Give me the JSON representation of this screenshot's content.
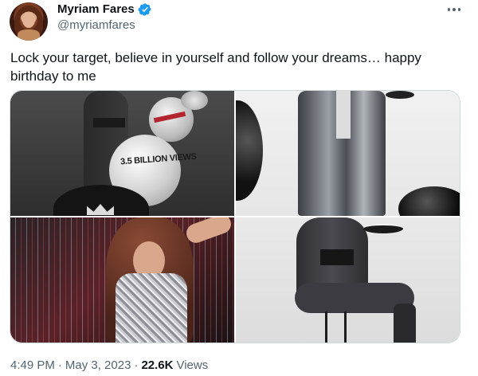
{
  "author": {
    "display_name": "Myriam Fares",
    "handle": "@myriamfares",
    "verified": true
  },
  "tweet": {
    "text": "Lock your target, believe in yourself and follow your dreams… happy birthday to me"
  },
  "media": {
    "image_overlay_text": "3.5 BILLION VIEWS"
  },
  "meta": {
    "time": "4:49 PM",
    "separator": "·",
    "date": "May 3, 2023",
    "views_count": "22.6K",
    "views_label": "Views"
  },
  "icons": {
    "verified": "verified-badge-icon",
    "more": "more-options-icon"
  },
  "colors": {
    "verified_blue": "#1d9bf0",
    "secondary_text": "#536471",
    "primary_text": "#0f1419",
    "border": "#cfd9de"
  }
}
